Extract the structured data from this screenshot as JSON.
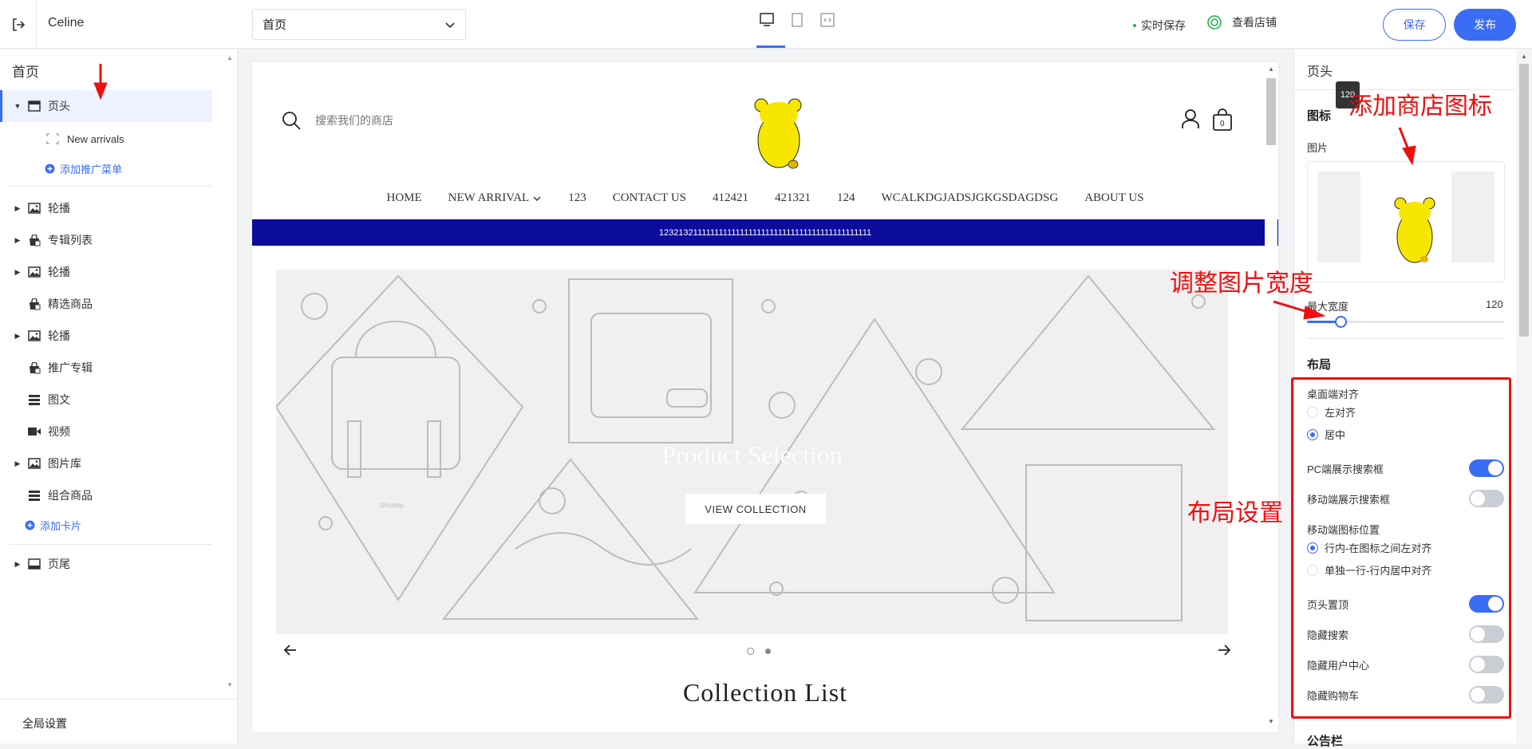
{
  "topbar": {
    "store_name": "Celine",
    "page_select": "首页",
    "autosave": "实时保存",
    "view_store": "查看店铺",
    "save": "保存",
    "publish": "发布"
  },
  "left": {
    "title": "首页",
    "header_item": "页头",
    "sub_item": "New arrivals",
    "add_promo_menu": "添加推广菜单",
    "items": [
      {
        "label": "轮播",
        "icon": "image-icon",
        "caret": true
      },
      {
        "label": "专辑列表",
        "icon": "collection-icon",
        "caret": true
      },
      {
        "label": "轮播",
        "icon": "image-icon",
        "caret": true
      },
      {
        "label": "精选商品",
        "icon": "collection-icon",
        "caret": false
      },
      {
        "label": "轮播",
        "icon": "image-icon",
        "caret": true
      },
      {
        "label": "推广专辑",
        "icon": "collection-icon",
        "caret": false
      },
      {
        "label": "图文",
        "icon": "text-image-icon",
        "caret": false
      },
      {
        "label": "视频",
        "icon": "video-icon",
        "caret": false
      },
      {
        "label": "图片库",
        "icon": "image-icon",
        "caret": true
      },
      {
        "label": "组合商品",
        "icon": "text-image-icon",
        "caret": false
      }
    ],
    "add_card": "添加卡片",
    "footer_item": "页尾",
    "global_settings": "全局设置"
  },
  "preview": {
    "search_placeholder": "搜索我们的商店",
    "cart_count": "0",
    "nav": [
      "HOME",
      "NEW ARRIVAL",
      "123",
      "CONTACT US",
      "412421",
      "421321",
      "124",
      "WCALKDGJADSJGKGSDAGDSG",
      "ABOUT US"
    ],
    "announcement": "1232132111111111111111111111111111111111111111111",
    "banner_title": "Product Selection",
    "banner_button": "VIEW COLLECTION",
    "banner_tag": "Shoptop",
    "collection_title": "Collection List"
  },
  "right": {
    "title": "页头",
    "tooltip": "120",
    "icon_section": "图标",
    "image_label": "图片",
    "max_width_label": "最大宽度",
    "max_width_value": "120",
    "max_width_fraction": 0.17,
    "layout_section": "布局",
    "desktop_align_label": "桌面端对齐",
    "align_left": "左对齐",
    "align_center": "居中",
    "pc_search_label": "PC端展示搜索框",
    "pc_search_on": true,
    "mobile_search_label": "移动端展示搜索框",
    "mobile_search_on": false,
    "mobile_icon_pos_label": "移动端图标位置",
    "mobile_icon_opt1": "行内-在图标之间左对齐",
    "mobile_icon_opt2": "单独一行-行内居中对齐",
    "sticky_header_label": "页头置顶",
    "sticky_header_on": true,
    "hide_search_label": "隐藏搜索",
    "hide_user_label": "隐藏用户中心",
    "hide_cart_label": "隐藏购物车",
    "next_section": "公告栏"
  },
  "annotations": {
    "add_icon": "添加商店图标",
    "adjust_width": "调整图片宽度",
    "layout_settings": "布局设置"
  },
  "colors": {
    "accent": "#3b6cf6",
    "announcement_bg": "#0b0b9c",
    "annotation": "#ee1010",
    "logo_yellow": "#f7e600"
  }
}
